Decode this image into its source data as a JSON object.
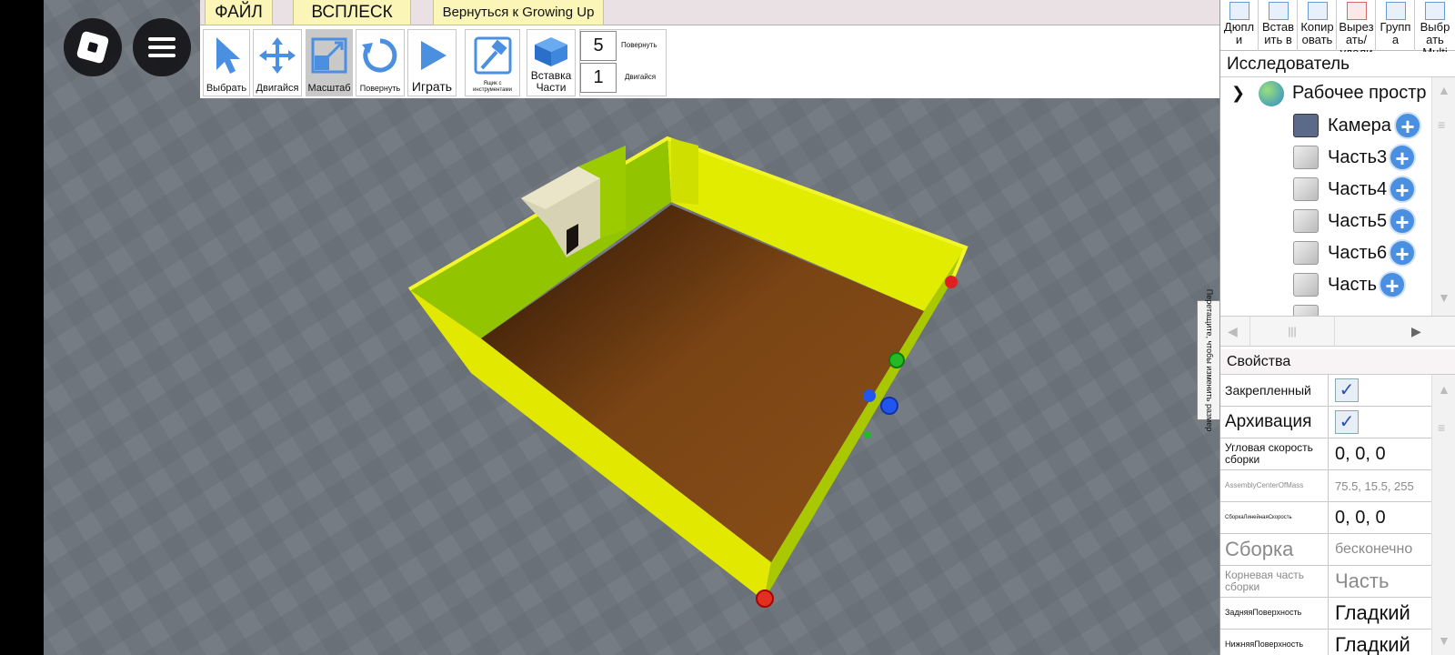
{
  "menubar": {
    "file": "ФАЙЛ",
    "splash": "ВСПЛЕСК",
    "back": "Вернуться к Growing Up"
  },
  "toolbar": {
    "select": "Выбрать",
    "move": "Двигайся",
    "scale": "Масштаб",
    "rotate": "Повернуть",
    "play": "Играть",
    "toolbox": "Ящик с инструментами",
    "insert_part": "Вставка Части",
    "rotate_step_value": "5",
    "rotate_step_label": "Повернуть",
    "move_step_value": "1",
    "move_step_label": "Двигайся"
  },
  "right_toolbar": {
    "duplicate": "Дюпл и",
    "paste_into": "Встав ить в",
    "copy": "Копир овать",
    "cut_delete": "Вырез ать/ удали",
    "group": "Групп а",
    "select_multi": "Выбр ать Multi"
  },
  "explorer": {
    "title": "Исследователь",
    "workspace": "Рабочее простр",
    "items": [
      "Камера",
      "Часть3",
      "Часть4",
      "Часть5",
      "Часть6",
      "Часть"
    ]
  },
  "drag_tab": "Перетащите, чтобы изменить размер",
  "properties": {
    "title": "Свойства",
    "rows": [
      {
        "name": "Закрепленный",
        "value": "✓"
      },
      {
        "name": "Архивация",
        "value": "✓"
      },
      {
        "name": "Угловая скорость сборки",
        "value": "0, 0, 0"
      },
      {
        "name": "AssemblyCenterOfMass",
        "value": "75.5, 15.5, 255"
      },
      {
        "name": "СборкаЛинейнаяСкорость",
        "value": "0, 0, 0"
      },
      {
        "name": "Сборка",
        "value": "бесконечно"
      },
      {
        "name": "Корневая часть сборки",
        "value": "Часть"
      },
      {
        "name": "ЗадняяПоверхность",
        "value": "Гладкий"
      },
      {
        "name": "НижняяПоверхность",
        "value": "Гладкий"
      }
    ]
  },
  "colors": {
    "wall": "#e8ee00",
    "floor": "#7a4414",
    "baseplate": "#6f757c",
    "menu_tab": "#fbf6b8"
  },
  "icons": [
    "roblox-logo-icon",
    "hamburger-menu-icon",
    "cursor-icon",
    "move-arrows-icon",
    "scale-icon",
    "rotate-icon",
    "play-icon",
    "hammer-icon",
    "part-cube-icon",
    "camera-icon",
    "globe-icon",
    "plus-icon",
    "checkbox-icon"
  ]
}
